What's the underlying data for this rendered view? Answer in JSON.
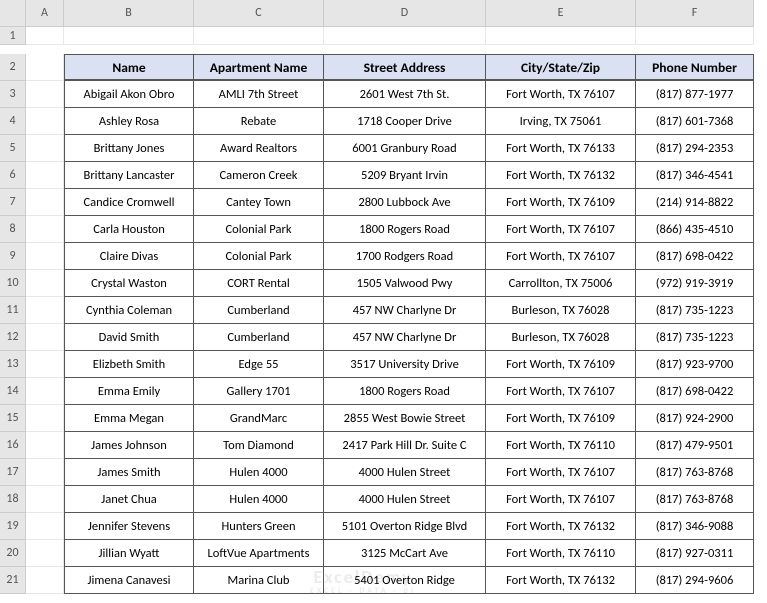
{
  "columns": [
    "A",
    "B",
    "C",
    "D",
    "E",
    "F"
  ],
  "row_numbers": [
    "1",
    "2",
    "3",
    "4",
    "5",
    "6",
    "7",
    "8",
    "9",
    "10",
    "11",
    "12",
    "13",
    "14",
    "15",
    "16",
    "17",
    "18",
    "19",
    "20",
    "21"
  ],
  "headers": {
    "name": "Name",
    "apartment": "Apartment Name",
    "street": "Street Address",
    "city": "City/State/Zip",
    "phone": "Phone Number"
  },
  "rows": [
    {
      "name": "Abigail Akon Obro",
      "apartment": "AMLI 7th Street",
      "street": "2601 West 7th St.",
      "city": "Fort Worth, TX 76107",
      "phone": "(817) 877-1977"
    },
    {
      "name": "Ashley Rosa",
      "apartment": "Rebate",
      "street": "1718 Cooper Drive",
      "city": "Irving, TX 75061",
      "phone": "(817) 601-7368"
    },
    {
      "name": "Brittany Jones",
      "apartment": "Award Realtors",
      "street": "6001 Granbury Road",
      "city": "Fort Worth, TX 76133",
      "phone": "(817) 294-2353"
    },
    {
      "name": "Brittany Lancaster",
      "apartment": "Cameron Creek",
      "street": "5209 Bryant Irvin",
      "city": "Fort Worth, TX 76132",
      "phone": "(817) 346-4541"
    },
    {
      "name": "Candice Cromwell",
      "apartment": "Cantey Town",
      "street": "2800 Lubbock Ave",
      "city": "Fort Worth, TX 76109",
      "phone": "(214) 914-8822"
    },
    {
      "name": "Carla Houston",
      "apartment": "Colonial Park",
      "street": "1800 Rogers Road",
      "city": "Fort Worth, TX 76107",
      "phone": "(866) 435-4510"
    },
    {
      "name": "Claire Divas",
      "apartment": "Colonial Park",
      "street": "1700 Rodgers Road",
      "city": "Fort Worth, TX 76107",
      "phone": "(817) 698-0422"
    },
    {
      "name": "Crystal Waston",
      "apartment": "CORT Rental",
      "street": "1505 Valwood Pwy",
      "city": "Carrollton, TX 75006",
      "phone": "(972) 919-3919"
    },
    {
      "name": "Cynthia Coleman",
      "apartment": "Cumberland",
      "street": "457 NW Charlyne Dr",
      "city": "Burleson, TX 76028",
      "phone": "(817) 735-1223"
    },
    {
      "name": "David Smith",
      "apartment": "Cumberland",
      "street": "457 NW Charlyne Dr",
      "city": "Burleson, TX 76028",
      "phone": "(817) 735-1223"
    },
    {
      "name": "Elizbeth Smith",
      "apartment": "Edge 55",
      "street": "3517 University Drive",
      "city": "Fort Worth, TX 76109",
      "phone": "(817) 923-9700"
    },
    {
      "name": "Emma Emily",
      "apartment": "Gallery 1701",
      "street": "1800 Rogers Road",
      "city": "Fort Worth, TX 76107",
      "phone": "(817) 698-0422"
    },
    {
      "name": "Emma Megan",
      "apartment": "GrandMarc",
      "street": "2855 West Bowie Street",
      "city": "Fort Worth, TX 76109",
      "phone": "(817) 924-2900"
    },
    {
      "name": "James Johnson",
      "apartment": "Tom Diamond",
      "street": "2417 Park Hill Dr. Suite C",
      "city": "Fort Worth, TX 76110",
      "phone": "(817) 479-9501"
    },
    {
      "name": "James Smith",
      "apartment": "Hulen 4000",
      "street": "4000 Hulen Street",
      "city": "Fort Worth, TX 76107",
      "phone": "(817) 763-8768"
    },
    {
      "name": "Janet Chua",
      "apartment": "Hulen 4000",
      "street": "4000 Hulen Street",
      "city": "Fort Worth, TX 76107",
      "phone": "(817) 763-8768"
    },
    {
      "name": "Jennifer Stevens",
      "apartment": "Hunters Green",
      "street": "5101 Overton Ridge Blvd",
      "city": "Fort Worth, TX 76132",
      "phone": "(817) 346-9088"
    },
    {
      "name": "Jillian Wyatt",
      "apartment": "LoftVue Apartments",
      "street": "3125 McCart Ave",
      "city": "Fort Worth, TX 76110",
      "phone": "(817) 927-0311"
    },
    {
      "name": "Jimena Canavesi",
      "apartment": "Marina Club",
      "street": "5401 Overton Ridge",
      "city": "Fort Worth, TX 76132",
      "phone": "(817) 294-9606"
    }
  ],
  "watermark": {
    "main": "ExcelDemy",
    "sub": "EXCEL · DATA · BI"
  }
}
